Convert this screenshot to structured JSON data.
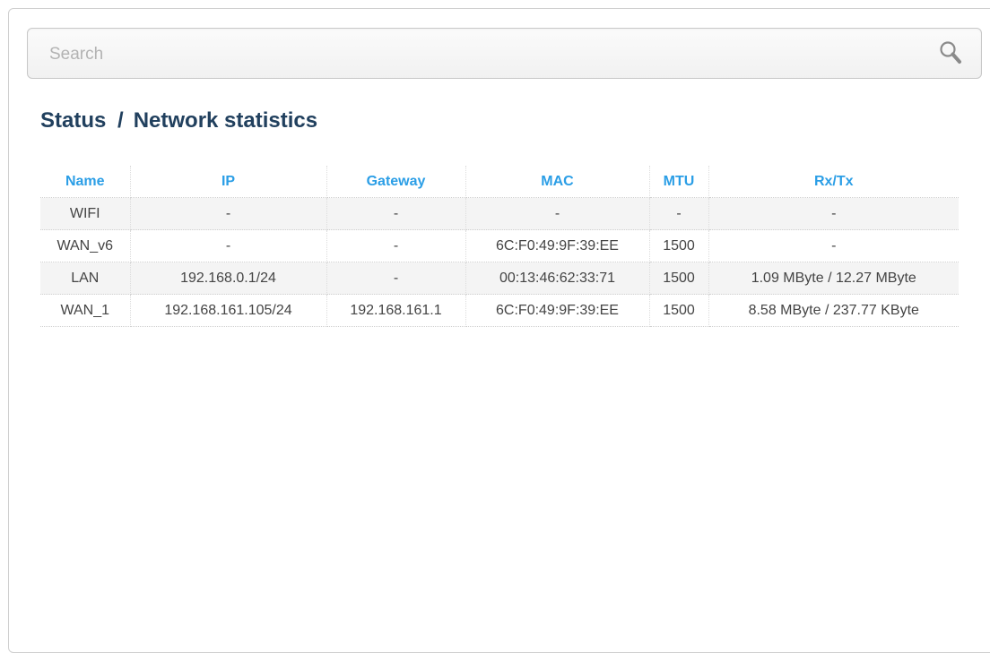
{
  "search": {
    "placeholder": "Search",
    "value": ""
  },
  "breadcrumb": {
    "section": "Status",
    "separator": "/",
    "page": "Network statistics"
  },
  "table": {
    "columns": [
      "Name",
      "IP",
      "Gateway",
      "MAC",
      "MTU",
      "Rx/Tx"
    ],
    "rows": [
      {
        "name": "WIFI",
        "status": "down",
        "ip": "-",
        "gateway": "-",
        "mac": "-",
        "mtu": "-",
        "rxtx": "-"
      },
      {
        "name": "WAN_v6",
        "status": "down",
        "ip": "-",
        "gateway": "-",
        "mac": "6C:F0:49:9F:39:EE",
        "mtu": "1500",
        "rxtx": "-"
      },
      {
        "name": "LAN",
        "status": "up",
        "ip": "192.168.0.1/24",
        "gateway": "-",
        "mac": "00:13:46:62:33:71",
        "mtu": "1500",
        "rxtx": "1.09 MByte / 12.27 MByte"
      },
      {
        "name": "WAN_1",
        "status": "up",
        "ip": "192.168.161.105/24",
        "gateway": "192.168.161.1",
        "mac": "6C:F0:49:9F:39:EE",
        "mtu": "1500",
        "rxtx": "8.58 MByte / 237.77 KByte"
      }
    ]
  },
  "colors": {
    "title": "#21405e",
    "header": "#2b9ee6",
    "status_down": "#e8312f",
    "status_up": "#2e8b24",
    "row_shade": "#f4f4f4"
  },
  "icons": {
    "search": "search-icon"
  }
}
